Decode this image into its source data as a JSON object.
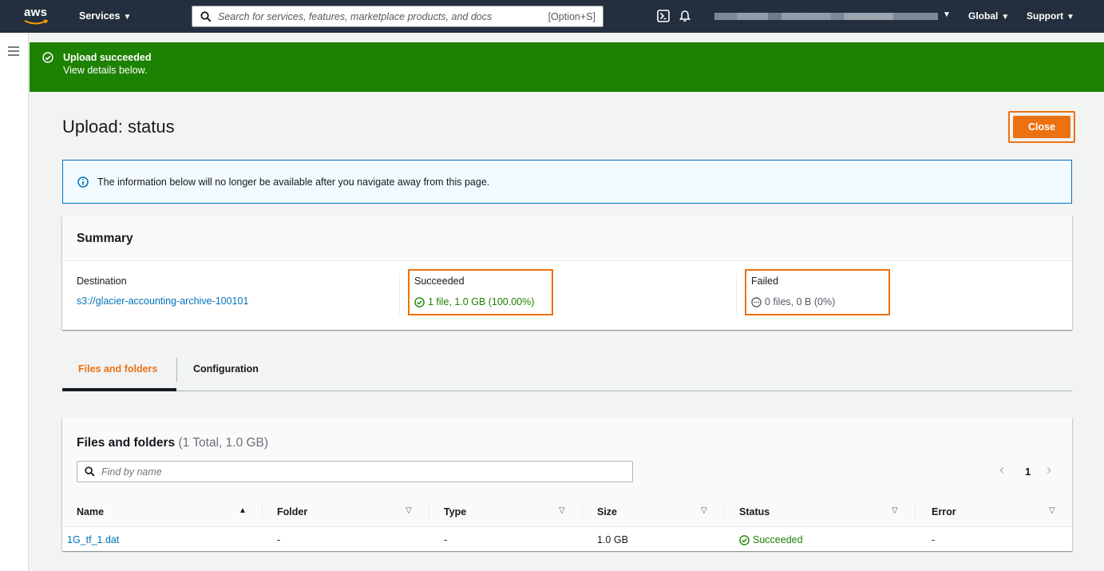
{
  "nav": {
    "logo_text": "aws",
    "services_label": "Services",
    "search_placeholder": "Search for services, features, marketplace products, and docs",
    "search_shortcut": "[Option+S]",
    "global_label": "Global",
    "support_label": "Support",
    "caret": "▼"
  },
  "flash": {
    "title": "Upload succeeded",
    "subtitle": "View details below."
  },
  "page": {
    "title": "Upload: status",
    "close_label": "Close",
    "info_text": "The information below will no longer be available after you navigate away from this page."
  },
  "summary": {
    "header": "Summary",
    "destination_label": "Destination",
    "destination_value": "s3://glacier-accounting-archive-100101",
    "succeeded_label": "Succeeded",
    "succeeded_value": "1 file, 1.0 GB (100.00%)",
    "failed_label": "Failed",
    "failed_value": "0 files, 0 B (0%)"
  },
  "tabs": [
    {
      "label": "Files and folders",
      "active": true
    },
    {
      "label": "Configuration",
      "active": false
    }
  ],
  "files": {
    "title": "Files and folders",
    "count": "(1 Total, 1.0 GB)",
    "find_placeholder": "Find by name",
    "page_number": "1",
    "prev": "‹",
    "next": "›",
    "columns": [
      "Name",
      "Folder",
      "Type",
      "Size",
      "Status",
      "Error"
    ],
    "sort_asc": "▲",
    "sort_none": "▽",
    "rows": [
      {
        "name": "1G_tf_1.dat",
        "folder": "-",
        "type": "-",
        "size": "1.0 GB",
        "status": "Succeeded",
        "error": "-"
      }
    ]
  },
  "colors": {
    "nav_bg": "#232f3e",
    "success": "#1d8102",
    "accent": "#ec7211",
    "link": "#0073bb"
  }
}
